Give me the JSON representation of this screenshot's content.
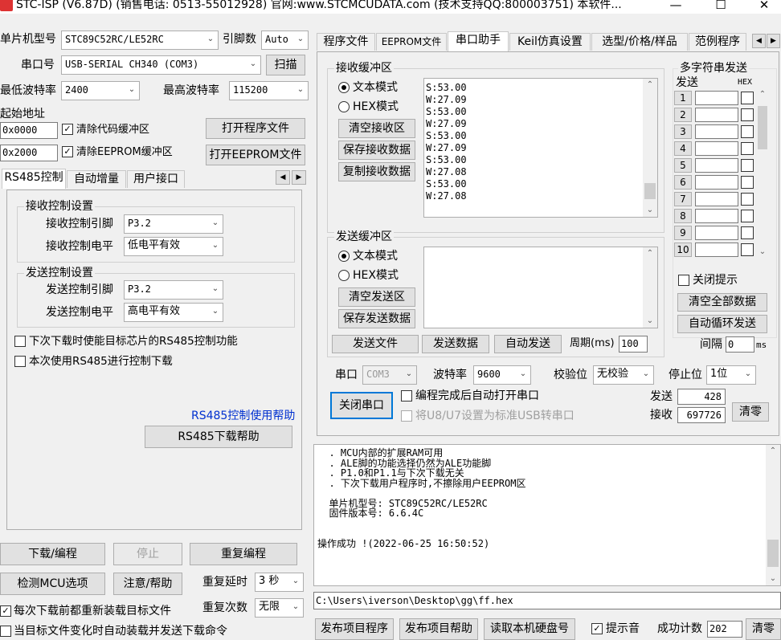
{
  "window": {
    "title": "STC-ISP (V6.87D) (销售电话: 0513-55012928) 官网:www.STCMCUDATA.com  (技术支持QQ:800003751) 本软件...",
    "minimize": "—",
    "maximize": "☐",
    "close": "✕"
  },
  "left": {
    "mcu_type_label": "单片机型号",
    "mcu_type_value": "STC89C52RC/LE52RC",
    "pin_count_label": "引脚数",
    "pin_count_value": "Auto",
    "port_label": "串口号",
    "port_value": "USB-SERIAL CH340 (COM3)",
    "scan_button": "扫描",
    "min_baud_label": "最低波特率",
    "min_baud_value": "2400",
    "max_baud_label": "最高波特率",
    "max_baud_value": "115200",
    "start_addr_label": "起始地址",
    "code_addr": "0x0000",
    "eeprom_addr": "0x2000",
    "clear_code_buffer": "清除代码缓冲区",
    "clear_eeprom_buffer": "清除EEPROM缓冲区",
    "open_program_button": "打开程序文件",
    "open_eeprom_button": "打开EEPROM文件",
    "tabs": [
      "RS485控制",
      "自动增量",
      "用户接口"
    ],
    "recv_group": "接收控制设置",
    "recv_pin_label": "接收控制引脚",
    "recv_pin_value": "P3.2",
    "recv_level_label": "接收控制电平",
    "recv_level_value": "低电平有效",
    "send_group": "发送控制设置",
    "send_pin_label": "发送控制引脚",
    "send_pin_value": "P3.2",
    "send_level_label": "发送控制电平",
    "send_level_value": "高电平有效",
    "opt_enable_rs485": "下次下载时使能目标芯片的RS485控制功能",
    "opt_use_rs485": "本次使用RS485进行控制下载",
    "help_link": "RS485控制使用帮助",
    "download_help_button": "RS485下载帮助",
    "download_button": "下载/编程",
    "stop_button": "停止",
    "reprogram_button": "重复编程",
    "check_mcu_button": "检测MCU选项",
    "notes_button": "注意/帮助",
    "repeat_delay_label": "重复延时",
    "repeat_delay_value": "3 秒",
    "repeat_count_label": "重复次数",
    "repeat_count_value": "无限",
    "opt_reload_each": "每次下载前都重新装载目标文件",
    "opt_auto_on_change": "当目标文件变化时自动装载并发送下载命令"
  },
  "right": {
    "tabs": [
      "程序文件",
      "EEPROM文件",
      "串口助手",
      "Keil仿真设置",
      "选型/价格/样品",
      "范例程序"
    ],
    "tab_scroll": [
      "◀",
      "▶"
    ],
    "recv": {
      "group": "接收缓冲区",
      "text_mode": "文本模式",
      "hex_mode": "HEX模式",
      "clear": "清空接收区",
      "save": "保存接收数据",
      "copy": "复制接收数据",
      "lines": [
        "S:53.00",
        "W:27.09",
        "S:53.00",
        "W:27.09",
        "S:53.00",
        "W:27.09",
        "S:53.00",
        "W:27.08",
        "S:53.00",
        "W:27.08"
      ]
    },
    "send": {
      "group": "发送缓冲区",
      "text_mode": "文本模式",
      "hex_mode": "HEX模式",
      "clear": "清空发送区",
      "save": "保存发送数据",
      "send_file": "发送文件",
      "send_data": "发送数据",
      "auto_send": "自动发送",
      "period_label": "周期(ms)",
      "period_value": "100"
    },
    "multi": {
      "group": "多字符串发送",
      "send_col": "发送",
      "hex_col": "HEX",
      "rows": [
        "1",
        "2",
        "3",
        "4",
        "5",
        "6",
        "7",
        "8",
        "9",
        "10"
      ],
      "close_tip": "关闭提示",
      "clear_all": "清空全部数据",
      "auto_loop": "自动循环发送",
      "interval_label": "间隔",
      "interval_value": "0",
      "interval_unit": "ms"
    },
    "serial": {
      "port_label": "串口",
      "port_value": "COM3",
      "baud_label": "波特率",
      "baud_value": "9600",
      "parity_label": "校验位",
      "parity_value": "无校验",
      "stop_label": "停止位",
      "stop_value": "1位",
      "close_port": "关闭串口",
      "auto_open": "编程完成后自动打开串口",
      "usb_set": "将U8/U7设置为标准USB转串口",
      "send_label": "发送",
      "send_count": "428",
      "recv_label": "接收",
      "recv_count": "697726",
      "clear_counts": "清零"
    }
  },
  "log": {
    "lines": [
      "  . MCU内部的扩展RAM可用",
      "  . ALE脚的功能选择仍然为ALE功能脚",
      "  . P1.0和P1.1与下次下载无关",
      "  . 下次下载用户程序时,不擦除用户EEPROM区",
      "",
      "  单片机型号: STC89C52RC/LE52RC",
      "  固件版本号: 6.6.4C",
      "",
      "",
      "操作成功 !(2022-06-25 16:50:52)"
    ]
  },
  "path": "C:\\Users\\iverson\\Desktop\\gg\\ff.hex",
  "bottom": {
    "publish_program": "发布项目程序",
    "publish_help": "发布项目帮助",
    "read_disk": "读取本机硬盘号",
    "beep": "提示音",
    "success_count_label": "成功计数",
    "success_count": "202",
    "clear": "清零"
  }
}
